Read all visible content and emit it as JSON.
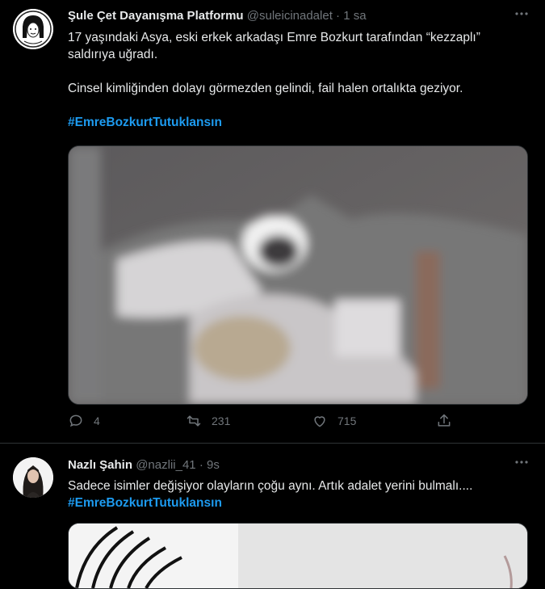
{
  "tweets": [
    {
      "author_name": "Şule Çet Dayanışma Platformu",
      "handle": "@suleicinadalet",
      "separator": "·",
      "time": "1 sa",
      "more_icon": "more-horizontal-icon",
      "text_line1": "17 yaşındaki Asya, eski erkek arkadaşı Emre Bozkurt tarafından “kezzaplı” saldırıya uğradı.",
      "text_line2": "Cinsel kimliğinden dolayı görmezden gelindi, fail halen ortalıkta geziyor.",
      "hashtag": "#EmreBozkurtTutuklansın",
      "actions": {
        "replies": "4",
        "retweets": "231",
        "likes": "715"
      }
    },
    {
      "author_name": "Nazlı Şahin",
      "handle": "@nazlii_41",
      "separator": "·",
      "time": "9s",
      "more_icon": "more-horizontal-icon",
      "text": "Sadece isimler değişiyor olayların çoğu aynı. Artık adalet yerini bulmalı....",
      "hashtag": "#EmreBozkurtTutuklansın"
    }
  ],
  "colors": {
    "background": "#000000",
    "link": "#1d9bf0",
    "secondary": "#71767b",
    "divider": "#2f3336"
  }
}
